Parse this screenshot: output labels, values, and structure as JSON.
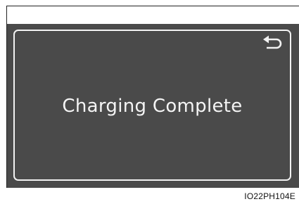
{
  "screen": {
    "message": "Charging Complete",
    "back_icon": "return-arrow-icon",
    "background_color": "#4a4a4a",
    "text_color": "#f4f4f4"
  },
  "figure": {
    "code": "IO22PH104E"
  }
}
